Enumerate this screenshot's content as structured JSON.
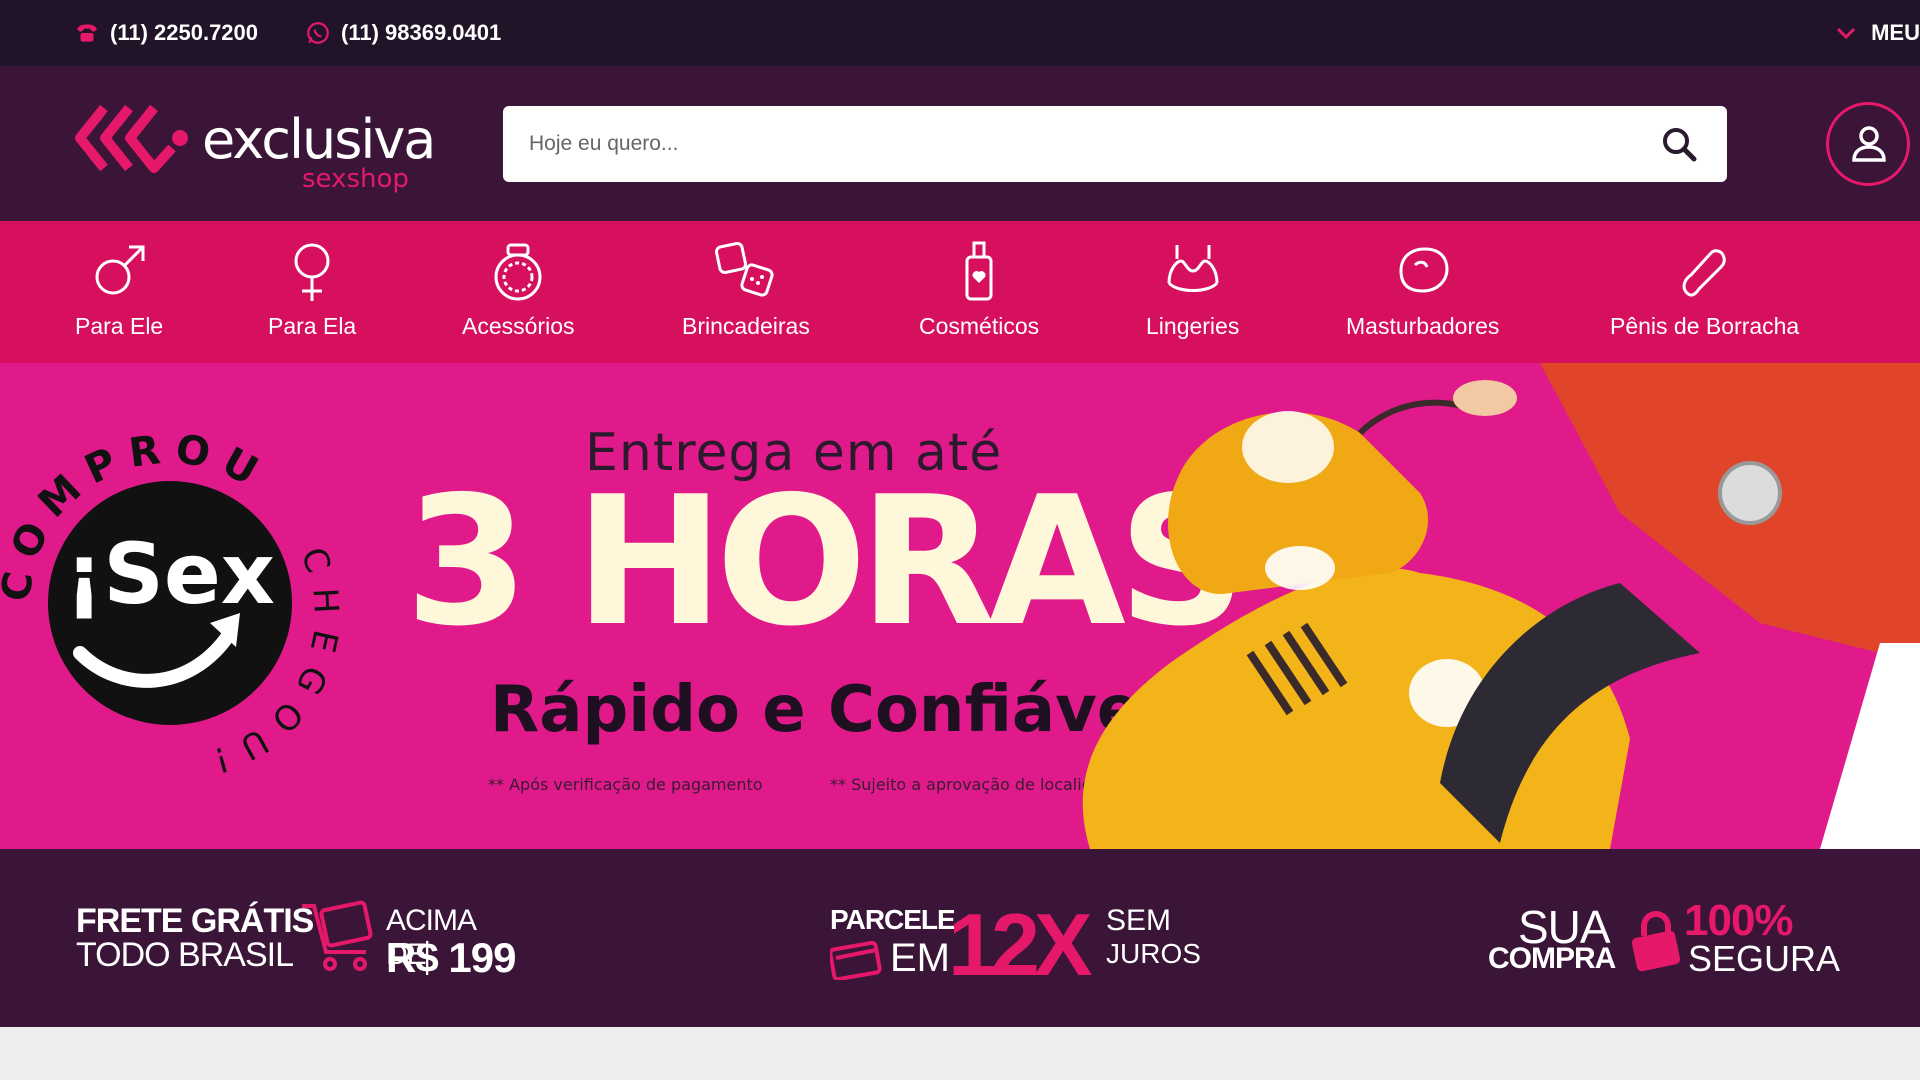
{
  "topbar": {
    "phone_label": "(11) 2250.7200",
    "whatsapp_label": "(11) 98369.0401",
    "menu_label": "MEU"
  },
  "header": {
    "logo_main": "exclusiva",
    "logo_sub": "sexshop",
    "search_placeholder": "Hoje eu quero..."
  },
  "categories": [
    {
      "label": "Para Ele",
      "icon": "male-symbol-icon"
    },
    {
      "label": "Para Ela",
      "icon": "female-symbol-icon"
    },
    {
      "label": "Acessórios",
      "icon": "ring-icon"
    },
    {
      "label": "Brincadeiras",
      "icon": "dice-icon"
    },
    {
      "label": "Cosméticos",
      "icon": "bottle-icon"
    },
    {
      "label": "Lingeries",
      "icon": "lingerie-icon"
    },
    {
      "label": "Masturbadores",
      "icon": "masturbator-icon"
    },
    {
      "label": "Pênis de Borracha",
      "icon": "rubber-toy-icon"
    }
  ],
  "banner": {
    "ring_top": "COMPROU",
    "ring_side": "CHEGOU!",
    "badge_text": "¡Sex",
    "headline_small": "Entrega em até",
    "headline_big": "3 HORAS",
    "subheadline": "Rápido e Confiável",
    "note_1": "** Após verificação de pagamento",
    "note_2": "** Sujeito a aprovação de localidade"
  },
  "badges": {
    "frete_line1": "FRETE GRÁTIS",
    "frete_line2": "TODO BRASIL",
    "frete_above": "ACIMA DE",
    "frete_value": "R$ 199",
    "parcele_line1": "PARCELE",
    "parcele_line2": "EM",
    "parcele_big": "12X",
    "parcele_sem": "SEM",
    "parcele_juros": "JUROS",
    "seg_sua": "SUA",
    "seg_compra": "COMPRA",
    "seg_pct": "100%",
    "seg_segura": "SEGURA"
  },
  "colors": {
    "topbar": "#221428",
    "header": "#3a1538",
    "categories_bar": "#d6105f",
    "banner": "#e01a8a",
    "accent": "#e6186a"
  }
}
